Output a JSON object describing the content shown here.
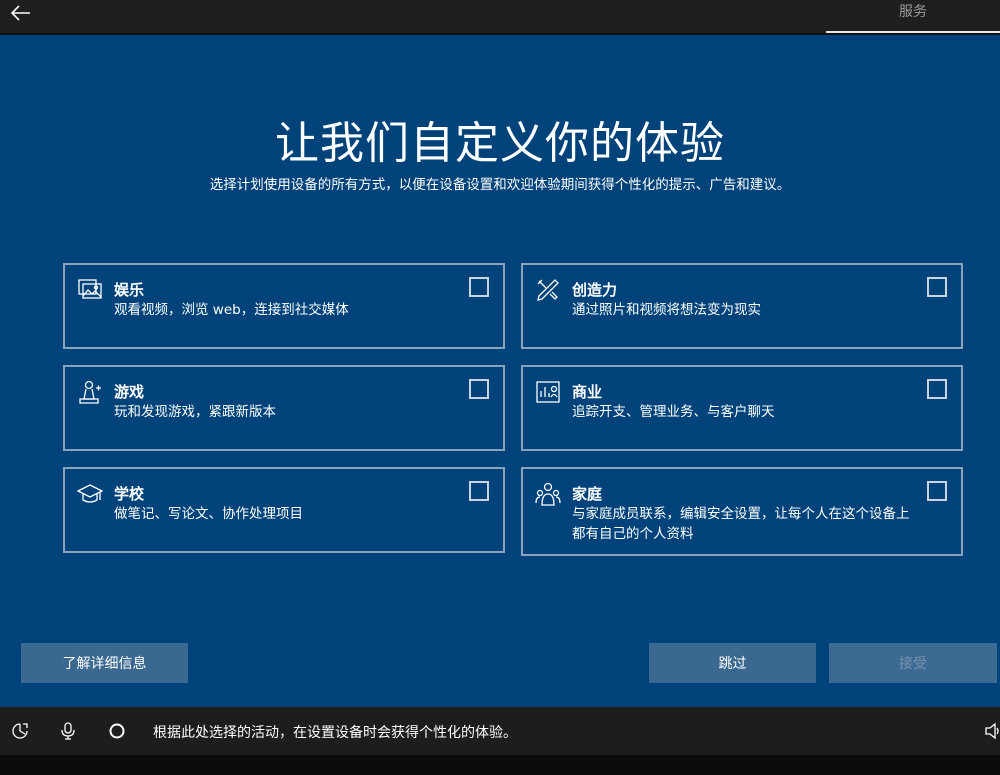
{
  "header": {
    "back_icon": "back-arrow-icon",
    "services_tab": "服务"
  },
  "main": {
    "title": "让我们自定义你的体验",
    "subtitle": "选择计划使用设备的所有方式，以便在设备设置和欢迎体验期间获得个性化的提示、广告和建议。",
    "cards": [
      {
        "title": "娱乐",
        "desc": "观看视频，浏览 web，连接到社交媒体",
        "icon": "entertainment-icon",
        "checked": false
      },
      {
        "title": "创造力",
        "desc": "通过照片和视频将想法变为现实",
        "icon": "creativity-icon",
        "checked": false
      },
      {
        "title": "游戏",
        "desc": "玩和发现游戏，紧跟新版本",
        "icon": "gaming-icon",
        "checked": false
      },
      {
        "title": "商业",
        "desc": "追踪开支、管理业务、与客户聊天",
        "icon": "business-icon",
        "checked": false
      },
      {
        "title": "学校",
        "desc": "做笔记、写论文、协作处理项目",
        "icon": "school-icon",
        "checked": false
      },
      {
        "title": "家庭",
        "desc": "与家庭成员联系，编辑安全设置，让每个人在这个设备上都有自己的个人资料",
        "icon": "family-icon",
        "checked": false
      }
    ]
  },
  "buttons": {
    "learn_more": "了解详细信息",
    "skip": "跳过",
    "accept": "接受"
  },
  "bottombar": {
    "narration": "根据此处选择的活动，在设置设备时会获得个性化的体验。",
    "icons": [
      "ease-of-access-icon",
      "microphone-icon",
      "cortana-icon",
      "volume-icon"
    ]
  },
  "colors": {
    "background": "#00437a",
    "card_border": "#8aa3bd",
    "button": "#3a6891",
    "bar": "#1d1d1d"
  }
}
